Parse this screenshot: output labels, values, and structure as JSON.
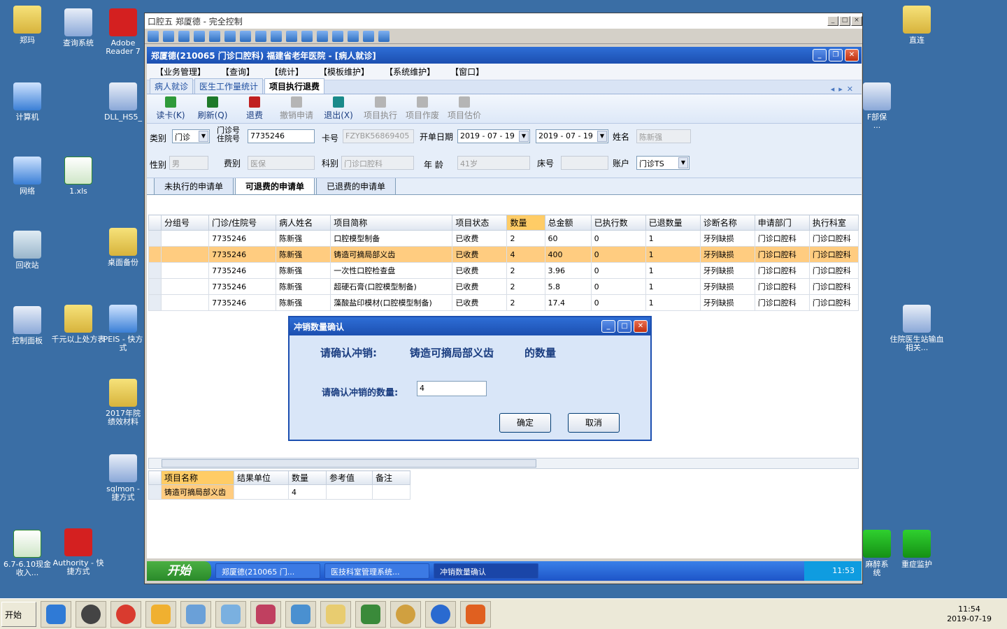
{
  "desktop_icons": [
    {
      "label": "郑玛",
      "icon": "user-folder-icon"
    },
    {
      "label": "查询系统",
      "icon": "pie-chart-icon"
    },
    {
      "label": "Adobe Reader 7",
      "icon": "pdf-icon"
    },
    {
      "label": "计算机",
      "icon": "computer-icon"
    },
    {
      "label": "DLL_HS5_",
      "icon": "dll-icon"
    },
    {
      "label": "网络",
      "icon": "network-icon"
    },
    {
      "label": "1.xls",
      "icon": "excel-icon"
    },
    {
      "label": "回收站",
      "icon": "recycle-bin-icon"
    },
    {
      "label": "桌面备份",
      "icon": "folder-icon"
    },
    {
      "label": "控制面板",
      "icon": "control-panel-icon"
    },
    {
      "label": "千元以上处方表",
      "icon": "folder-icon"
    },
    {
      "label": "PEIS - 快方式",
      "icon": "shield-icon"
    },
    {
      "label": "2017年院绩效材料",
      "icon": "folder-icon"
    },
    {
      "label": "sqlmon - 捷方式",
      "icon": "sql-icon"
    },
    {
      "label": "6.7-6.10现金收入...",
      "icon": "excel-icon"
    },
    {
      "label": "Authority - 快捷方式",
      "icon": "red-cross-icon"
    },
    {
      "label": "直连",
      "icon": "folder-icon"
    },
    {
      "label": "F部保 ...",
      "icon": "document-icon"
    },
    {
      "label": "住院医生站输血相关...",
      "icon": "document-icon"
    },
    {
      "label": "麻醉系统",
      "icon": "green-u-icon"
    },
    {
      "label": "重症监护",
      "icon": "green-u-icon"
    }
  ],
  "remote_window": {
    "title": "口腔五 郑厦德 - 完全控制"
  },
  "app": {
    "title": "郑厦德(210065 门诊口腔科) 福建省老年医院 - [病人就诊]",
    "menu": [
      "【业务管理】",
      "【查询】",
      "【统计】",
      "【模板维护】",
      "【系统维护】",
      "【窗口】"
    ],
    "doc_tabs": [
      "病人就诊",
      "医生工作量统计",
      "项目执行退费"
    ],
    "actions": [
      {
        "label": "读卡(K)",
        "icon": "card-reader-icon",
        "enabled": true
      },
      {
        "label": "刷新(Q)",
        "icon": "refresh-icon",
        "enabled": true
      },
      {
        "label": "退费",
        "icon": "refund-icon",
        "enabled": true
      },
      {
        "label": "撤销申请",
        "icon": "undo-icon",
        "enabled": false
      },
      {
        "label": "退出(X)",
        "icon": "exit-icon",
        "enabled": true
      },
      {
        "label": "项目执行",
        "icon": "execute-icon",
        "enabled": false
      },
      {
        "label": "项目作废",
        "icon": "trash-icon",
        "enabled": false
      },
      {
        "label": "项目估价",
        "icon": "eraser-icon",
        "enabled": false
      }
    ],
    "form": {
      "type_label": "类别",
      "type_value": "门诊",
      "visit_no_label": "门诊号住院号",
      "visit_no_value": "7735246",
      "card_label": "卡号",
      "card_value": "FZYBK56869405",
      "date_label": "开单日期",
      "date_from": "2019 - 07 - 19",
      "date_to": "2019 - 07 - 19",
      "name_label": "姓名",
      "name_value": "陈新强",
      "sex_label": "性别",
      "sex_value": "男",
      "fee_label": "费别",
      "fee_value": "医保",
      "dept_label": "科别",
      "dept_value": "门诊口腔科",
      "age_label": "年  龄",
      "age_value": "41岁",
      "bed_label": "床号",
      "bed_value": "",
      "account_label": "账户",
      "account_value": "门诊TS"
    },
    "sub_tabs": [
      "未执行的申请单",
      "可退费的申请单",
      "已退费的申请单"
    ],
    "grid": {
      "headers": [
        "分组号",
        "门诊/住院号",
        "病人姓名",
        "项目简称",
        "项目状态",
        "数量",
        "总金额",
        "已执行数",
        "已退数量",
        "诊断名称",
        "申请部门",
        "执行科室"
      ],
      "rows": [
        [
          "",
          "7735246",
          "陈新强",
          "口腔模型制备",
          "已收费",
          "2",
          "60",
          "0",
          "1",
          "牙列缺损",
          "门诊口腔科",
          "门诊口腔科"
        ],
        [
          "",
          "7735246",
          "陈新强",
          "铸造可摘局部义齿",
          "已收费",
          "4",
          "400",
          "0",
          "1",
          "牙列缺损",
          "门诊口腔科",
          "门诊口腔科"
        ],
        [
          "",
          "7735246",
          "陈新强",
          "一次性口腔检查盘",
          "已收费",
          "2",
          "3.96",
          "0",
          "1",
          "牙列缺损",
          "门诊口腔科",
          "门诊口腔科"
        ],
        [
          "",
          "7735246",
          "陈新强",
          "超硬石膏(口腔模型制备)",
          "已收费",
          "2",
          "5.8",
          "0",
          "1",
          "牙列缺损",
          "门诊口腔科",
          "门诊口腔科"
        ],
        [
          "",
          "7735246",
          "陈新强",
          "藻酸盐印模材(口腔模型制备)",
          "已收费",
          "2",
          "17.4",
          "0",
          "1",
          "牙列缺损",
          "门诊口腔科",
          "门诊口腔科"
        ]
      ],
      "selected_row": 1
    },
    "detail": {
      "headers": [
        "项目名称",
        "结果单位",
        "数量",
        "参考值",
        "备注"
      ],
      "rows": [
        [
          "铸造可摘局部义齿",
          "",
          "4",
          "",
          ""
        ]
      ]
    }
  },
  "dialog": {
    "title": "冲销数量确认",
    "question_prefix": "请确认冲销:",
    "item_name": "铸造可摘局部义齿",
    "question_suffix": "的数量",
    "qty_label": "请确认冲销的数量:",
    "qty_value": "4",
    "ok_label": "确定",
    "cancel_label": "取消"
  },
  "remote_taskbar": {
    "start_label": "开始",
    "items": [
      "郑厦德(210065 门...",
      "医技科室管理系统...",
      "冲销数量确认"
    ],
    "clock": "11:53"
  },
  "host_taskbar": {
    "start_label": "开始",
    "time": "11:54",
    "date": "2019-07-19"
  },
  "colors": {
    "desktop": "#3a6ea5",
    "title_blue": "#1c4fb0",
    "selected_row": "#ffcc80",
    "highlight_header": "#ffcc66"
  }
}
